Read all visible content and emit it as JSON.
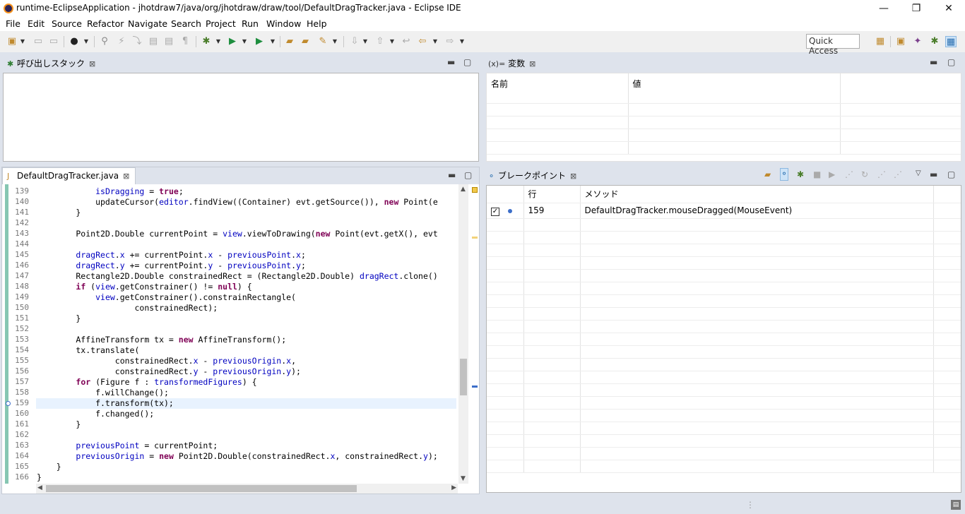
{
  "window": {
    "title": "runtime-EclipseApplication - jhotdraw7/java/org/jhotdraw/draw/tool/DefaultDragTracker.java - Eclipse IDE",
    "minimize": "—",
    "restore": "❐",
    "close": "✕"
  },
  "menu": [
    {
      "label": "File"
    },
    {
      "label": "Edit"
    },
    {
      "label": "Source"
    },
    {
      "label": "Refactor"
    },
    {
      "label": "Navigate"
    },
    {
      "label": "Search"
    },
    {
      "label": "Project"
    },
    {
      "label": "Run"
    },
    {
      "label": "Window"
    },
    {
      "label": "Help"
    }
  ],
  "toolbar": {
    "quick_access": "Quick Access"
  },
  "callstack": {
    "tab_label": "呼び出しスタック"
  },
  "variables": {
    "tab_label": "変数",
    "tab_prefix": "(x)=",
    "columns": [
      "名前",
      "値",
      ""
    ]
  },
  "editor": {
    "tab_label": "DefaultDragTracker.java",
    "lines": [
      {
        "n": "139",
        "html": "            <span class=\"fd\">isDragging</span> = <span class=\"kw\">true</span>;"
      },
      {
        "n": "140",
        "html": "            updateCursor(<span class=\"fd\">editor</span>.findView((Container) evt.getSource()), <span class=\"kw\">new</span> Point(e"
      },
      {
        "n": "141",
        "html": "        }"
      },
      {
        "n": "142",
        "html": ""
      },
      {
        "n": "143",
        "html": "        Point2D.Double currentPoint = <span class=\"fd\">view</span>.viewToDrawing(<span class=\"kw\">new</span> Point(evt.getX(), evt"
      },
      {
        "n": "144",
        "html": ""
      },
      {
        "n": "145",
        "html": "        <span class=\"fd\">dragRect</span>.<span class=\"fd\">x</span> += currentPoint.<span class=\"fd\">x</span> - <span class=\"fd\">previousPoint</span>.<span class=\"fd\">x</span>;"
      },
      {
        "n": "146",
        "html": "        <span class=\"fd\">dragRect</span>.<span class=\"fd\">y</span> += currentPoint.<span class=\"fd\">y</span> - <span class=\"fd\">previousPoint</span>.<span class=\"fd\">y</span>;"
      },
      {
        "n": "147",
        "html": "        Rectangle2D.Double constrainedRect = (Rectangle2D.Double) <span class=\"fd\">dragRect</span>.clone()"
      },
      {
        "n": "148",
        "html": "        <span class=\"kw\">if</span> (<span class=\"fd\">view</span>.getConstrainer() != <span class=\"kw\">null</span>) {"
      },
      {
        "n": "149",
        "html": "            <span class=\"fd\">view</span>.getConstrainer().constrainRectangle("
      },
      {
        "n": "150",
        "html": "                    constrainedRect);"
      },
      {
        "n": "151",
        "html": "        }"
      },
      {
        "n": "152",
        "html": ""
      },
      {
        "n": "153",
        "html": "        AffineTransform tx = <span class=\"kw\">new</span> AffineTransform();"
      },
      {
        "n": "154",
        "html": "        tx.translate("
      },
      {
        "n": "155",
        "html": "                constrainedRect.<span class=\"fd\">x</span> - <span class=\"fd\">previousOrigin</span>.<span class=\"fd\">x</span>,"
      },
      {
        "n": "156",
        "html": "                constrainedRect.<span class=\"fd\">y</span> - <span class=\"fd\">previousOrigin</span>.<span class=\"fd\">y</span>);"
      },
      {
        "n": "157",
        "html": "        <span class=\"kw\">for</span> (Figure f : <span class=\"fd\">transformedFigures</span>) {"
      },
      {
        "n": "158",
        "html": "            f.willChange();"
      },
      {
        "n": "159",
        "html": "            f.transform(tx);"
      },
      {
        "n": "160",
        "html": "            f.changed();"
      },
      {
        "n": "161",
        "html": "        }"
      },
      {
        "n": "162",
        "html": ""
      },
      {
        "n": "163",
        "html": "        <span class=\"fd\">previousPoint</span> = currentPoint;"
      },
      {
        "n": "164",
        "html": "        <span class=\"fd\">previousOrigin</span> = <span class=\"kw\">new</span> Point2D.Double(constrainedRect.<span class=\"fd\">x</span>, constrainedRect.<span class=\"fd\">y</span>);"
      },
      {
        "n": "165",
        "html": "    }"
      },
      {
        "n": "166",
        "html": "}"
      }
    ],
    "current_line": "159"
  },
  "breakpoints": {
    "tab_label": "ブレークポイント",
    "columns": [
      "",
      "行",
      "メソッド",
      ""
    ],
    "rows": [
      {
        "checked": true,
        "line": "159",
        "method": "DefaultDragTracker.mouseDragged(MouseEvent)"
      }
    ]
  }
}
